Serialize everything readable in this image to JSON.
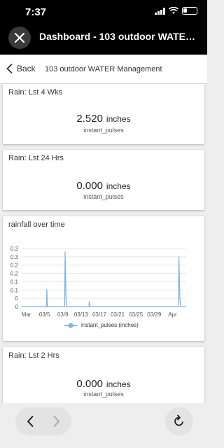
{
  "status": {
    "time": "7:37"
  },
  "header": {
    "title": "Dashboard - 103 outdoor WATER M..."
  },
  "nav": {
    "back_label": "Back",
    "page_title": "103 outdoor WATER Management"
  },
  "cards": [
    {
      "title": "Rain: Lst 4 Wks",
      "value": "2.520",
      "unit": "inches",
      "sub": "instant_pulses"
    },
    {
      "title": "Rain: Lst 24 Hrs",
      "value": "0.000",
      "unit": "inches",
      "sub": "instant_pulses"
    },
    {
      "title": "Rain: Lst 2 Hrs",
      "value": "0.000",
      "unit": "inches",
      "sub": "instant_pulses"
    }
  ],
  "chart_card": {
    "title": "rainfall over time"
  },
  "chart_data": {
    "type": "line",
    "title": "rainfall over time",
    "xlabel": "",
    "ylabel": "",
    "x_tick_labels": [
      "Mar",
      "03/5",
      "03/9",
      "03/13",
      "03/17",
      "03/21",
      "03/25",
      "03/29",
      "Apr"
    ],
    "y_tick_labels": [
      "0",
      "0",
      "0.1",
      "0.1",
      "0.2",
      "0.2",
      "0.3",
      "0.3"
    ],
    "ylim": [
      0,
      0.34
    ],
    "series": [
      {
        "name": "instant_pulses (inches)",
        "color": "#7cb5ec",
        "x_days": [
          0,
          5.4,
          5.5,
          5.6,
          5.8,
          9.4,
          9.5,
          9.7,
          9.9,
          14.7,
          14.8,
          14.95,
          34.3,
          34.4,
          34.6,
          34.8,
          36
        ],
        "values": [
          0,
          0,
          0.1,
          0,
          0,
          0,
          0.32,
          0.05,
          0,
          0,
          0.03,
          0,
          0,
          0.29,
          0.05,
          0,
          0
        ]
      }
    ],
    "grid": true,
    "legend": "bottom"
  },
  "icons": {
    "close": "close-icon",
    "back": "chevron-left-icon",
    "prev": "arrow-left-icon",
    "next": "arrow-right-icon",
    "reload": "reload-icon"
  }
}
